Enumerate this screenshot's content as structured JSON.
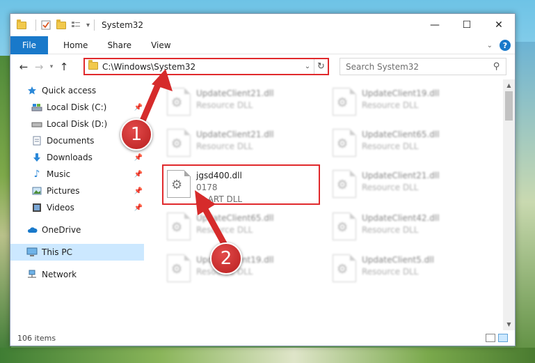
{
  "window": {
    "title": "System32",
    "controls": {
      "minimize": "—",
      "maximize": "☐",
      "close": "✕"
    }
  },
  "ribbon": {
    "tabs": [
      "File",
      "Home",
      "Share",
      "View"
    ],
    "help": "?"
  },
  "address": {
    "path": "C:\\Windows\\System32",
    "search_placeholder": "Search System32"
  },
  "nav": {
    "items": [
      {
        "label": "Quick access",
        "icon": "star-icon",
        "pinned": false
      },
      {
        "label": "Local Disk (C:)",
        "icon": "drive-icon",
        "pinned": true
      },
      {
        "label": "Local Disk (D:)",
        "icon": "drive-icon",
        "pinned": false
      },
      {
        "label": "Documents",
        "icon": "documents-icon",
        "pinned": true
      },
      {
        "label": "Downloads",
        "icon": "download-icon",
        "pinned": true
      },
      {
        "label": "Music",
        "icon": "music-icon",
        "pinned": true
      },
      {
        "label": "Pictures",
        "icon": "pictures-icon",
        "pinned": true
      },
      {
        "label": "Videos",
        "icon": "videos-icon",
        "pinned": true
      },
      {
        "label": "OneDrive",
        "icon": "cloud-icon",
        "pinned": false
      },
      {
        "label": "This PC",
        "icon": "computer-icon",
        "pinned": false
      },
      {
        "label": "Network",
        "icon": "network-icon",
        "pinned": false
      }
    ],
    "selected": "This PC"
  },
  "files": [
    {
      "name": "UpdateClient21.dll",
      "type": "Resource DLL",
      "blurred": true
    },
    {
      "name": "UpdateClient19.dll",
      "type": "Resource DLL",
      "blurred": true
    },
    {
      "name": "UpdateClient21.dll",
      "type": "Resource DLL",
      "blurred": true
    },
    {
      "name": "UpdateClient65.dll",
      "type": "Resource DLL",
      "blurred": true
    },
    {
      "name": "jgsd400.dll",
      "version": "0178",
      "type": "JG ART DLL",
      "blurred": false
    },
    {
      "name": "UpdateClient21.dll",
      "type": "Resource DLL",
      "blurred": true
    },
    {
      "name": "UpdateClient65.dll",
      "type": "Resource DLL",
      "blurred": true
    },
    {
      "name": "UpdateClient42.dll",
      "type": "Resource DLL",
      "blurred": true
    },
    {
      "name": "UpdateClient19.dll",
      "type": "Resource DLL",
      "blurred": true
    },
    {
      "name": "UpdateClient5.dll",
      "type": "Resource DLL",
      "blurred": true
    }
  ],
  "status": {
    "item_count": "106 items"
  },
  "annotations": {
    "step1": "1",
    "step2": "2"
  },
  "colors": {
    "accent": "#1979ca",
    "highlight": "#e0292c",
    "selected_bg": "#cce8ff"
  }
}
